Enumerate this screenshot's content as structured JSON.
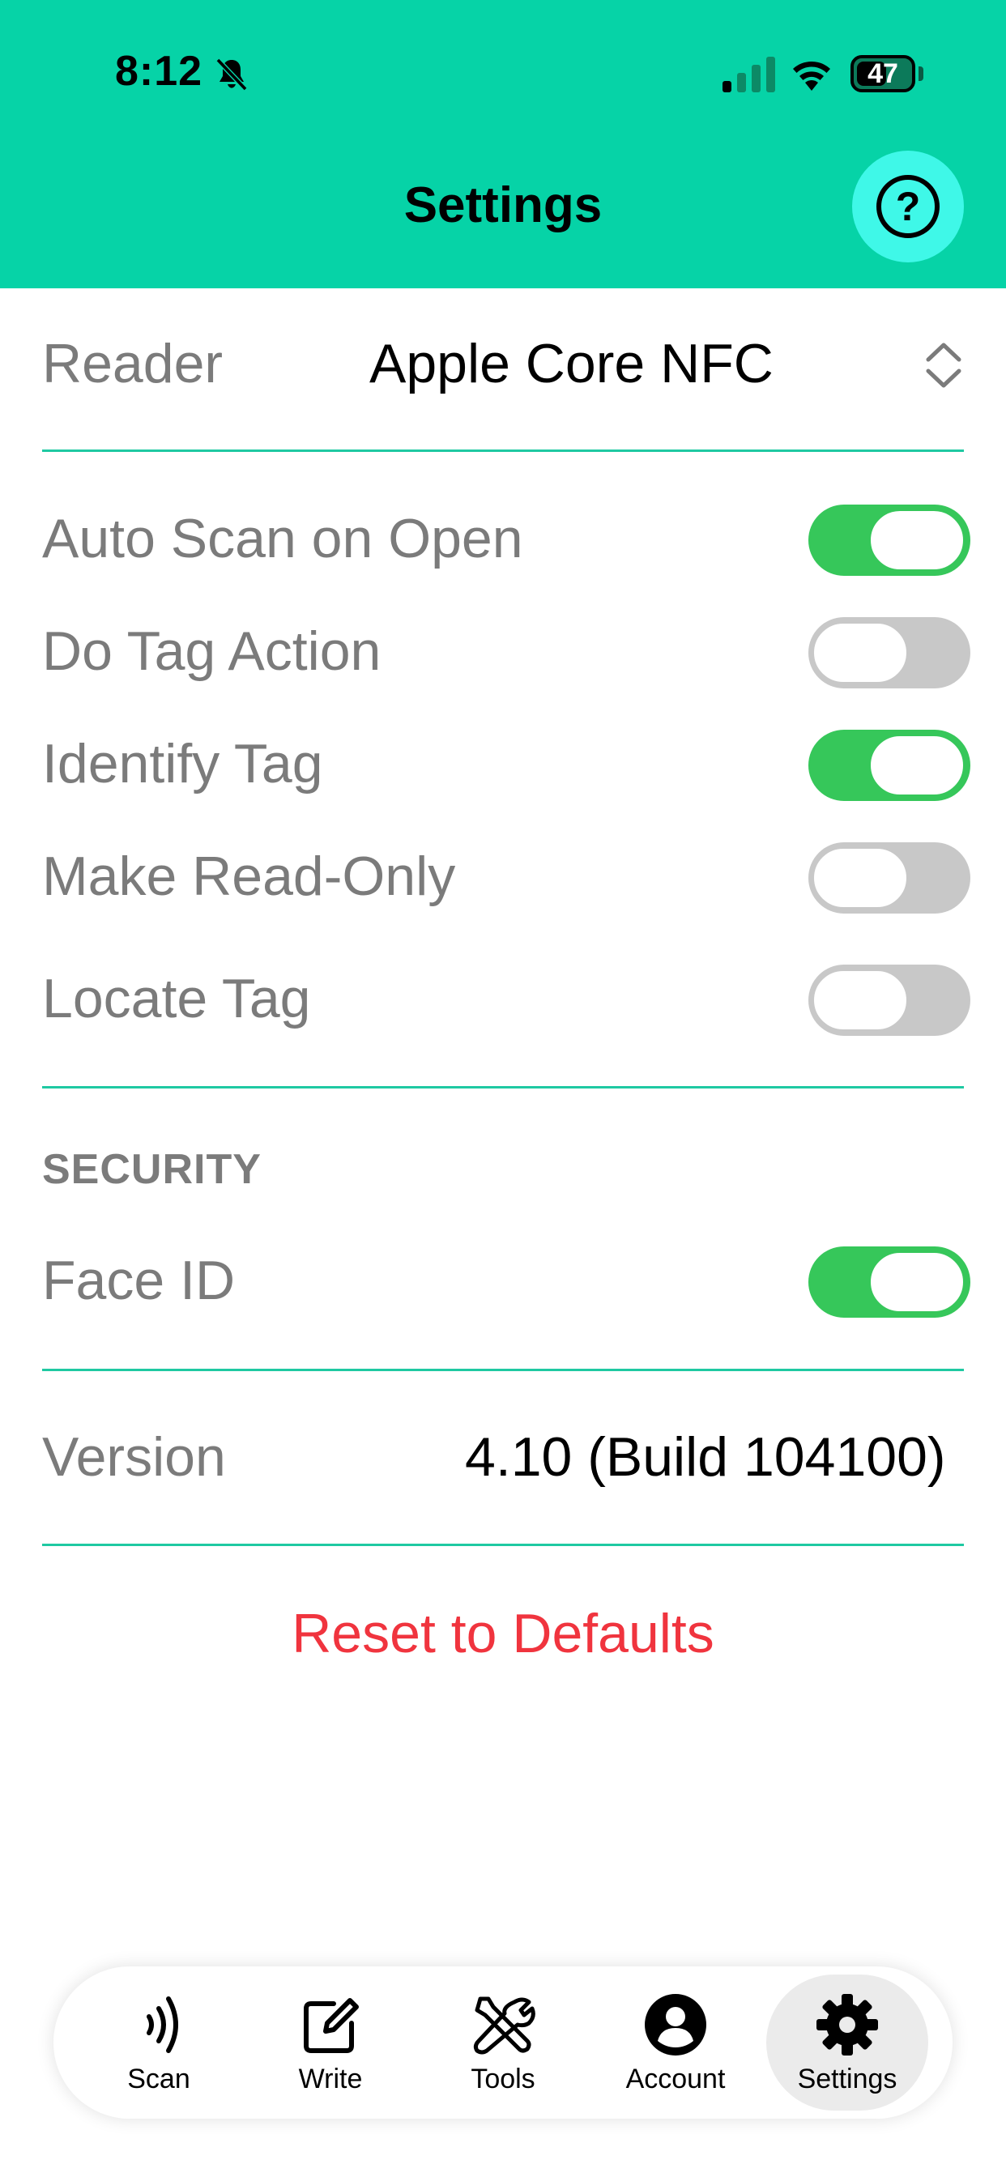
{
  "status_bar": {
    "time": "8:12",
    "battery": "47"
  },
  "header": {
    "title": "Settings",
    "help_icon": "question-circle-icon"
  },
  "reader": {
    "label": "Reader",
    "value": "Apple Core NFC"
  },
  "options": [
    {
      "label": "Auto Scan on Open",
      "enabled": true
    },
    {
      "label": "Do Tag Action",
      "enabled": false
    },
    {
      "label": "Identify Tag",
      "enabled": true
    },
    {
      "label": "Make Read-Only",
      "enabled": false
    },
    {
      "label": "Locate Tag",
      "enabled": false
    }
  ],
  "security": {
    "header": "SECURITY",
    "face_id": {
      "label": "Face ID",
      "enabled": true
    }
  },
  "version": {
    "label": "Version",
    "value": "4.10 (Build 104100)"
  },
  "reset_label": "Reset to Defaults",
  "tabs": [
    {
      "label": "Scan",
      "icon": "nfc-waves-icon",
      "active": false
    },
    {
      "label": "Write",
      "icon": "edit-icon",
      "active": false
    },
    {
      "label": "Tools",
      "icon": "tools-icon",
      "active": false
    },
    {
      "label": "Account",
      "icon": "account-icon",
      "active": false
    },
    {
      "label": "Settings",
      "icon": "gear-icon",
      "active": true
    }
  ],
  "colors": {
    "header_bg": "#06d3a7",
    "help_button": "#3ff8e8",
    "toggle_on": "#36c75a",
    "toggle_off": "#c8c8c8",
    "divider": "#1fc9a2",
    "reset": "#f0343e"
  }
}
